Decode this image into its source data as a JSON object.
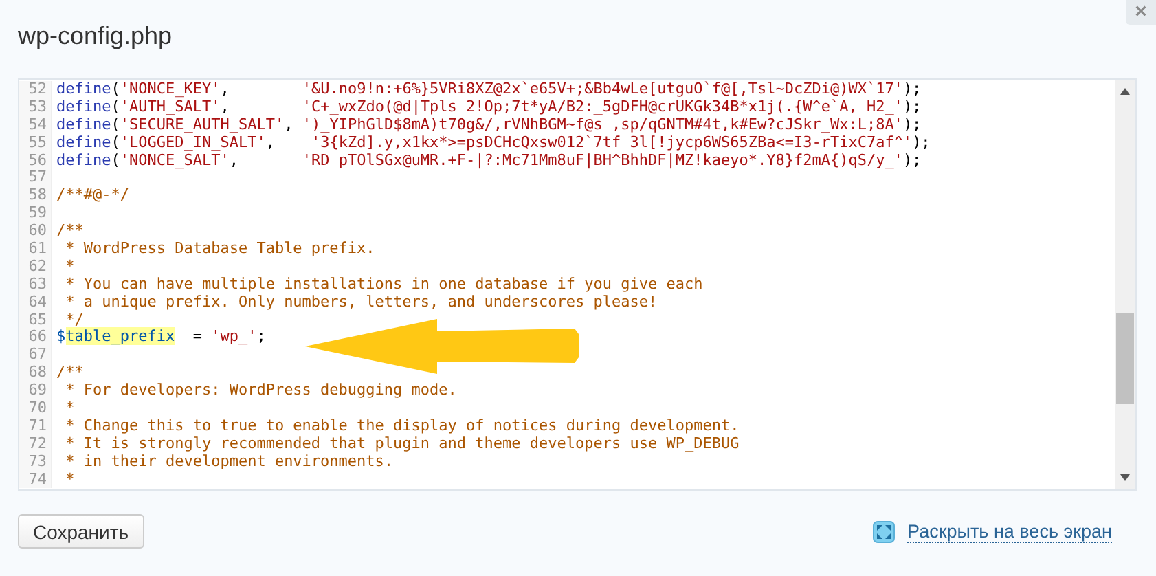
{
  "dialog": {
    "title": "wp-config.php",
    "close": "×"
  },
  "editor": {
    "lines": [
      {
        "number": "52",
        "tokens": [
          {
            "kind": "keyword",
            "text": "define"
          },
          {
            "kind": "plain",
            "text": "("
          },
          {
            "kind": "string",
            "text": "'NONCE_KEY'"
          },
          {
            "kind": "plain",
            "text": ",        "
          },
          {
            "kind": "string",
            "text": "'&U.no9!n:+6%}5VRi8XZ@2x`e65V+;&Bb4wLe[utguO`f@[,Tsl~DcZDi@)WX`17'"
          },
          {
            "kind": "plain",
            "text": ");"
          }
        ]
      },
      {
        "number": "53",
        "tokens": [
          {
            "kind": "keyword",
            "text": "define"
          },
          {
            "kind": "plain",
            "text": "("
          },
          {
            "kind": "string",
            "text": "'AUTH_SALT'"
          },
          {
            "kind": "plain",
            "text": ",        "
          },
          {
            "kind": "string",
            "text": "'C+_wxZdo(@d|Tpls 2!Op;7t*yA/B2:_5gDFH@crUKGk34B*x1j(.{W^e`A, H2_'"
          },
          {
            "kind": "plain",
            "text": ");"
          }
        ]
      },
      {
        "number": "54",
        "tokens": [
          {
            "kind": "keyword",
            "text": "define"
          },
          {
            "kind": "plain",
            "text": "("
          },
          {
            "kind": "string",
            "text": "'SECURE_AUTH_SALT'"
          },
          {
            "kind": "plain",
            "text": ", "
          },
          {
            "kind": "string",
            "text": "')_YIPhGlD$8mA)t70g&/,rVNhBGM~f@s ,sp/qGNTM#4t,k#Ew?cJSkr_Wx:L;8A'"
          },
          {
            "kind": "plain",
            "text": ");"
          }
        ]
      },
      {
        "number": "55",
        "tokens": [
          {
            "kind": "keyword",
            "text": "define"
          },
          {
            "kind": "plain",
            "text": "("
          },
          {
            "kind": "string",
            "text": "'LOGGED_IN_SALT'"
          },
          {
            "kind": "plain",
            "text": ",    "
          },
          {
            "kind": "string",
            "text": "'3{kZd].y,x1kx*>=psDCHcQxsw012`7tf 3l[!jycp6WS65ZBa<=I3-rTixC7af^'"
          },
          {
            "kind": "plain",
            "text": ");"
          }
        ]
      },
      {
        "number": "56",
        "tokens": [
          {
            "kind": "keyword",
            "text": "define"
          },
          {
            "kind": "plain",
            "text": "("
          },
          {
            "kind": "string",
            "text": "'NONCE_SALT'"
          },
          {
            "kind": "plain",
            "text": ",       "
          },
          {
            "kind": "string",
            "text": "'RD pTOlSGx@uMR.+F-|?:Mc71Mm8uF|BH^BhhDF|MZ!kaeyo*.Y8}f2mA{)qS/y_'"
          },
          {
            "kind": "plain",
            "text": ");"
          }
        ]
      },
      {
        "number": "57"
      },
      {
        "number": "58",
        "tokens": [
          {
            "kind": "comment",
            "text": "/**#@-*/"
          }
        ]
      },
      {
        "number": "59"
      },
      {
        "number": "60",
        "tokens": [
          {
            "kind": "comment",
            "text": "/**"
          }
        ]
      },
      {
        "number": "61",
        "tokens": [
          {
            "kind": "comment",
            "text": " * WordPress Database Table prefix."
          }
        ]
      },
      {
        "number": "62",
        "tokens": [
          {
            "kind": "comment",
            "text": " *"
          }
        ]
      },
      {
        "number": "63",
        "tokens": [
          {
            "kind": "comment",
            "text": " * You can have multiple installations in one database if you give each"
          }
        ]
      },
      {
        "number": "64",
        "tokens": [
          {
            "kind": "comment",
            "text": " * a unique prefix. Only numbers, letters, and underscores please!"
          }
        ]
      },
      {
        "number": "65",
        "tokens": [
          {
            "kind": "comment",
            "text": " */"
          }
        ]
      },
      {
        "number": "66",
        "tokens": [
          {
            "kind": "variable",
            "text": "$"
          },
          {
            "kind": "match",
            "text": "table_prefix"
          },
          {
            "kind": "plain",
            "text": "  = "
          },
          {
            "kind": "string",
            "text": "'wp_'"
          },
          {
            "kind": "plain",
            "text": ";"
          }
        ]
      },
      {
        "number": "67"
      },
      {
        "number": "68",
        "tokens": [
          {
            "kind": "comment",
            "text": "/**"
          }
        ]
      },
      {
        "number": "69",
        "tokens": [
          {
            "kind": "comment",
            "text": " * For developers: WordPress debugging mode."
          }
        ]
      },
      {
        "number": "70",
        "tokens": [
          {
            "kind": "comment",
            "text": " *"
          }
        ]
      },
      {
        "number": "71",
        "tokens": [
          {
            "kind": "comment",
            "text": " * Change this to true to enable the display of notices during development."
          }
        ]
      },
      {
        "number": "72",
        "tokens": [
          {
            "kind": "comment",
            "text": " * It is strongly recommended that plugin and theme developers use WP_DEBUG"
          }
        ]
      },
      {
        "number": "73",
        "tokens": [
          {
            "kind": "comment",
            "text": " * in their development environments."
          }
        ]
      },
      {
        "number": "74",
        "tokens": [
          {
            "kind": "comment",
            "text": " *"
          }
        ]
      }
    ]
  },
  "save_button": "Сохранить",
  "fullscreen_link": "Раскрыть на весь экран"
}
